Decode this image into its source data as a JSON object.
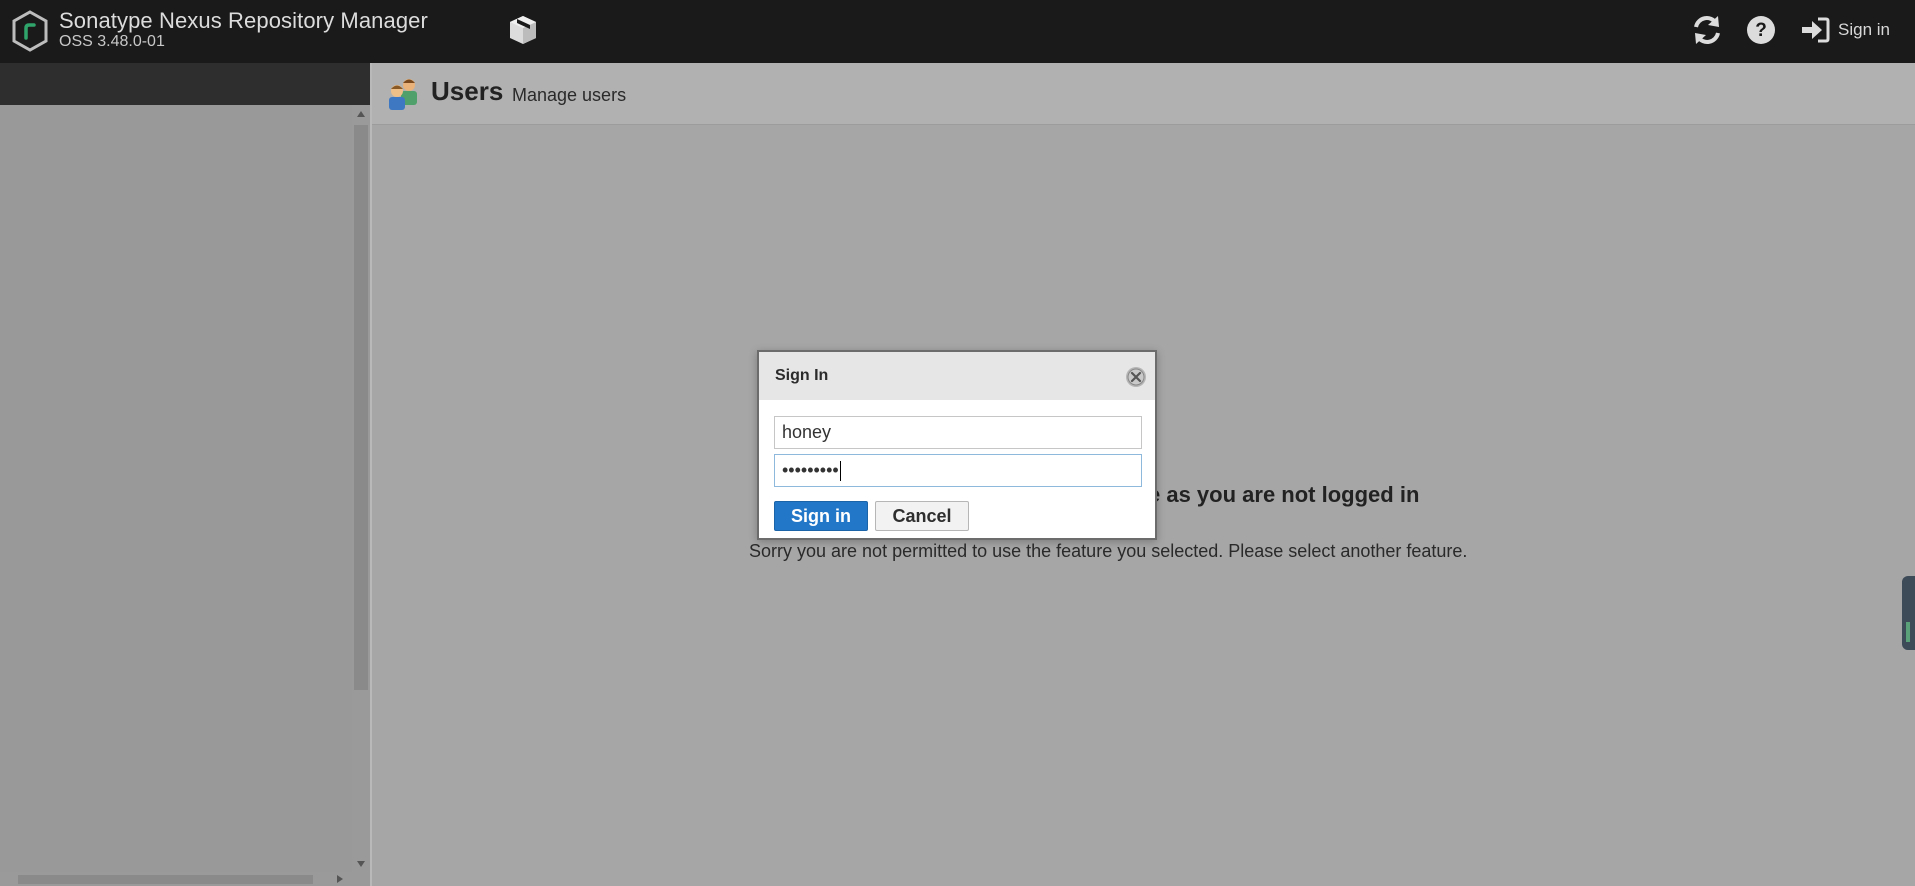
{
  "header": {
    "title": "Sonatype Nexus Repository Manager",
    "version": "OSS 3.48.0-01",
    "signin_label": "Sign in",
    "icons": [
      "nexus-logo-icon",
      "browse-cube-icon",
      "refresh-icon",
      "help-icon",
      "sign-in-icon"
    ]
  },
  "page": {
    "title": "Users",
    "subtitle": "Manage users",
    "icon": "users-icon"
  },
  "message": {
    "heading_visible": "e as you are not logged in",
    "body": "Sorry you are not permitted to use the feature you selected. Please select another feature."
  },
  "dialog": {
    "title": "Sign In",
    "username_value": "honey",
    "password_value": "•••••••••",
    "signin_button": "Sign in",
    "cancel_button": "Cancel",
    "close_icon": "close-circle-icon"
  },
  "colors": {
    "header_bg": "#1a1a1a",
    "primary_button": "#2377c8",
    "overlay_bg": "#a6a6a6"
  }
}
